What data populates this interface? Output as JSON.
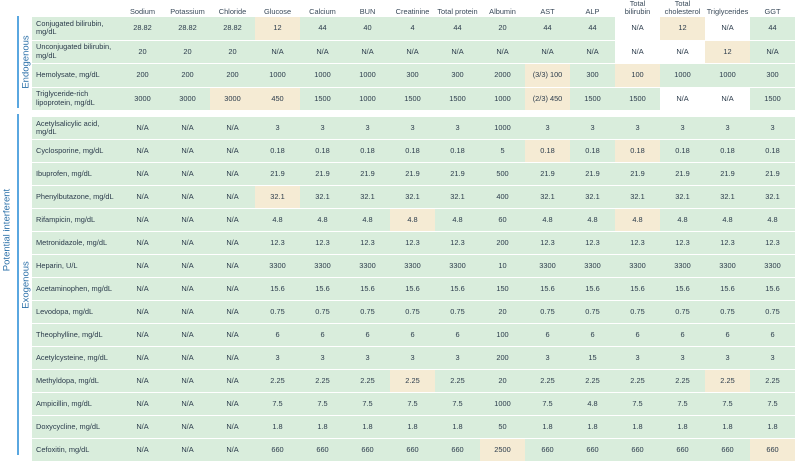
{
  "side_label": "Potential interferent",
  "group_endogenous": "Endogenous",
  "group_exogenous": "Exogenous",
  "columns": [
    "Sodium",
    "Potassium",
    "Chloride",
    "Glucose",
    "Calcium",
    "BUN",
    "Creatinine",
    "Total protein",
    "Albumin",
    "AST",
    "ALP",
    "Total bilirubin",
    "Total cholesterol",
    "Triglycerides",
    "GGT"
  ],
  "endogenous": [
    {
      "label": "Conjugated bilirubin, mg/dL",
      "cells": [
        "28.82",
        "28.82",
        "28.82",
        "12",
        "44",
        "40",
        "4",
        "44",
        "20",
        "44",
        "44",
        "N/A",
        "12",
        "N/A",
        "44"
      ],
      "highlight": [
        3,
        12
      ]
    },
    {
      "label": "Unconjugated bilirubin, mg/dL",
      "cells": [
        "20",
        "20",
        "20",
        "N/A",
        "N/A",
        "N/A",
        "N/A",
        "N/A",
        "N/A",
        "N/A",
        "N/A",
        "N/A",
        "N/A",
        "12",
        "N/A"
      ],
      "highlight": [
        13
      ]
    },
    {
      "label": "Hemolysate, mg/dL",
      "cells": [
        "200",
        "200",
        "200",
        "1000",
        "1000",
        "1000",
        "300",
        "300",
        "2000",
        "(3/3) 100",
        "300",
        "100",
        "1000",
        "1000",
        "300"
      ],
      "highlight": [
        9,
        11
      ]
    },
    {
      "label": "Triglyceride-rich lipoprotein, mg/dL",
      "cells": [
        "3000",
        "3000",
        "3000",
        "450",
        "1500",
        "1000",
        "1500",
        "1500",
        "1000",
        "(2/3) 450",
        "1500",
        "1500",
        "N/A",
        "N/A",
        "1500"
      ],
      "highlight": [
        2,
        3,
        9
      ]
    }
  ],
  "exogenous": [
    {
      "label": "Acetylsalicylic acid, mg/dL",
      "cells": [
        "N/A",
        "N/A",
        "N/A",
        "3",
        "3",
        "3",
        "3",
        "3",
        "1000",
        "3",
        "3",
        "3",
        "3",
        "3",
        "3"
      ],
      "highlight": []
    },
    {
      "label": "Cyclosporine, mg/dL",
      "cells": [
        "N/A",
        "N/A",
        "N/A",
        "0.18",
        "0.18",
        "0.18",
        "0.18",
        "0.18",
        "5",
        "0.18",
        "0.18",
        "0.18",
        "0.18",
        "0.18",
        "0.18"
      ],
      "highlight": [
        9,
        11
      ]
    },
    {
      "label": "Ibuprofen, mg/dL",
      "cells": [
        "N/A",
        "N/A",
        "N/A",
        "21.9",
        "21.9",
        "21.9",
        "21.9",
        "21.9",
        "500",
        "21.9",
        "21.9",
        "21.9",
        "21.9",
        "21.9",
        "21.9"
      ],
      "highlight": []
    },
    {
      "label": "Phenylbutazone, mg/dL",
      "cells": [
        "N/A",
        "N/A",
        "N/A",
        "32.1",
        "32.1",
        "32.1",
        "32.1",
        "32.1",
        "400",
        "32.1",
        "32.1",
        "32.1",
        "32.1",
        "32.1",
        "32.1"
      ],
      "highlight": [
        3
      ]
    },
    {
      "label": "Rifampicin, mg/dL",
      "cells": [
        "N/A",
        "N/A",
        "N/A",
        "4.8",
        "4.8",
        "4.8",
        "4.8",
        "4.8",
        "60",
        "4.8",
        "4.8",
        "4.8",
        "4.8",
        "4.8",
        "4.8"
      ],
      "highlight": [
        6,
        11
      ]
    },
    {
      "label": "Metronidazole, mg/dL",
      "cells": [
        "N/A",
        "N/A",
        "N/A",
        "12.3",
        "12.3",
        "12.3",
        "12.3",
        "12.3",
        "200",
        "12.3",
        "12.3",
        "12.3",
        "12.3",
        "12.3",
        "12.3"
      ],
      "highlight": []
    },
    {
      "label": "Heparin, U/L",
      "cells": [
        "N/A",
        "N/A",
        "N/A",
        "3300",
        "3300",
        "3300",
        "3300",
        "3300",
        "10",
        "3300",
        "3300",
        "3300",
        "3300",
        "3300",
        "3300"
      ],
      "highlight": []
    },
    {
      "label": "Acetaminophen, mg/dL",
      "cells": [
        "N/A",
        "N/A",
        "N/A",
        "15.6",
        "15.6",
        "15.6",
        "15.6",
        "15.6",
        "150",
        "15.6",
        "15.6",
        "15.6",
        "15.6",
        "15.6",
        "15.6"
      ],
      "highlight": []
    },
    {
      "label": "Levodopa, mg/dL",
      "cells": [
        "N/A",
        "N/A",
        "N/A",
        "0.75",
        "0.75",
        "0.75",
        "0.75",
        "0.75",
        "20",
        "0.75",
        "0.75",
        "0.75",
        "0.75",
        "0.75",
        "0.75"
      ],
      "highlight": []
    },
    {
      "label": "Theophylline, mg/dL",
      "cells": [
        "N/A",
        "N/A",
        "N/A",
        "6",
        "6",
        "6",
        "6",
        "6",
        "100",
        "6",
        "6",
        "6",
        "6",
        "6",
        "6"
      ],
      "highlight": []
    },
    {
      "label": "Acetylcysteine, mg/dL",
      "cells": [
        "N/A",
        "N/A",
        "N/A",
        "3",
        "3",
        "3",
        "3",
        "3",
        "200",
        "3",
        "15",
        "3",
        "3",
        "3",
        "3"
      ],
      "highlight": []
    },
    {
      "label": "Methyldopa, mg/dL",
      "cells": [
        "N/A",
        "N/A",
        "N/A",
        "2.25",
        "2.25",
        "2.25",
        "2.25",
        "2.25",
        "20",
        "2.25",
        "2.25",
        "2.25",
        "2.25",
        "2.25",
        "2.25"
      ],
      "highlight": [
        6,
        13
      ]
    },
    {
      "label": "Ampicillin, mg/dL",
      "cells": [
        "N/A",
        "N/A",
        "N/A",
        "7.5",
        "7.5",
        "7.5",
        "7.5",
        "7.5",
        "1000",
        "7.5",
        "4.8",
        "7.5",
        "7.5",
        "7.5",
        "7.5"
      ],
      "highlight": []
    },
    {
      "label": "Doxycycline, mg/dL",
      "cells": [
        "N/A",
        "N/A",
        "N/A",
        "1.8",
        "1.8",
        "1.8",
        "1.8",
        "1.8",
        "50",
        "1.8",
        "1.8",
        "1.8",
        "1.8",
        "1.8",
        "1.8"
      ],
      "highlight": []
    },
    {
      "label": "Cefoxitin, mg/dL",
      "cells": [
        "N/A",
        "N/A",
        "N/A",
        "660",
        "660",
        "660",
        "660",
        "660",
        "2500",
        "660",
        "660",
        "660",
        "660",
        "660",
        "660"
      ],
      "highlight": [
        8,
        14
      ]
    }
  ],
  "colors": {
    "cell": "#d9eddc",
    "highlight": "#f5ebd4",
    "accent": "#2a6fa8"
  }
}
